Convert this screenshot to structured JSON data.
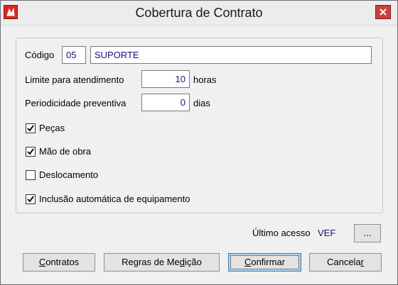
{
  "window": {
    "title": "Cobertura de Contrato"
  },
  "form": {
    "codigo": {
      "label": "Código",
      "code": "05",
      "description": "SUPORTE"
    },
    "limite": {
      "label": "Limite para atendimento",
      "value": "10",
      "unit": "horas"
    },
    "periodicidade": {
      "label": "Periodicidade preventiva",
      "value": "0",
      "unit": "dias"
    },
    "checkboxes": [
      {
        "label": "Peças",
        "checked": true
      },
      {
        "label": "Mão de obra",
        "checked": true
      },
      {
        "label": "Deslocamento",
        "checked": false
      },
      {
        "label": "Inclusão automática de equipamento",
        "checked": true
      }
    ]
  },
  "footer": {
    "ultimo_acesso_label": "Último acesso",
    "ultimo_acesso_value": "VEF",
    "ellipsis_label": "..."
  },
  "buttons": {
    "contratos": {
      "prefix": "",
      "mnemonic": "C",
      "suffix": "ontratos"
    },
    "regras": {
      "prefix": "Regras de Me",
      "mnemonic": "d",
      "suffix": "ição"
    },
    "confirmar": {
      "prefix": "",
      "mnemonic": "C",
      "suffix": "onfirmar"
    },
    "cancelar": {
      "prefix": "Cancela",
      "mnemonic": "r",
      "suffix": ""
    }
  },
  "icons": {
    "app": "app-icon",
    "close": "close-icon",
    "check": "check-icon"
  }
}
